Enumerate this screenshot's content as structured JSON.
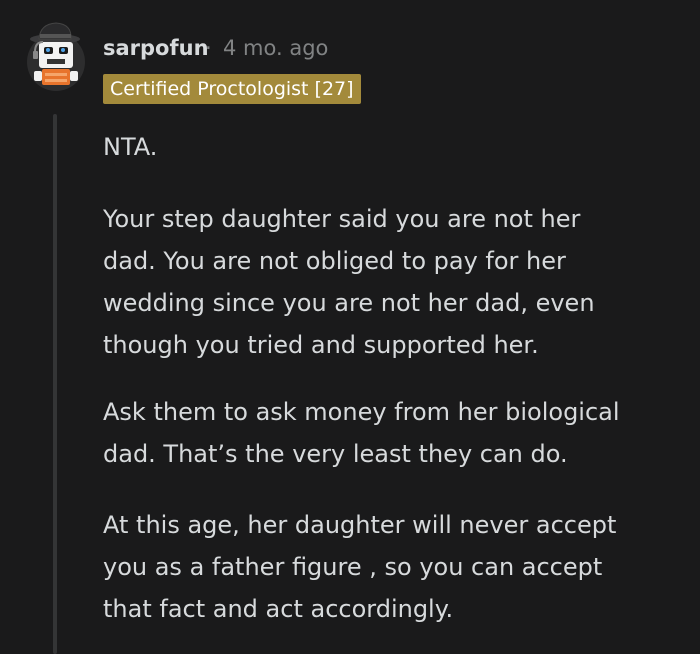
{
  "comment": {
    "author": "sarpofun",
    "separator": "·",
    "timestamp": "4 mo. ago",
    "flair": "Certified Proctologist [27]",
    "paragraphs": [
      "NTA.",
      "Your step daughter said you are not her\ndad. You are not obliged to pay for her\nwedding since you are not her dad, even\nthough you tried and supported her.",
      "Ask them to ask money from her biological\ndad. That’s the very least they can do.",
      "At this age, her daughter will never accept\nyou as a father figure , so you can accept\nthat fact and act accordingly."
    ]
  },
  "colors": {
    "background": "#1a1a1b",
    "text": "#d7dadc",
    "meta": "#818384",
    "flair_bg": "#a38a3b",
    "thread_line": "#343536"
  },
  "icons": {
    "avatar": "snoo-avatar-icon"
  }
}
